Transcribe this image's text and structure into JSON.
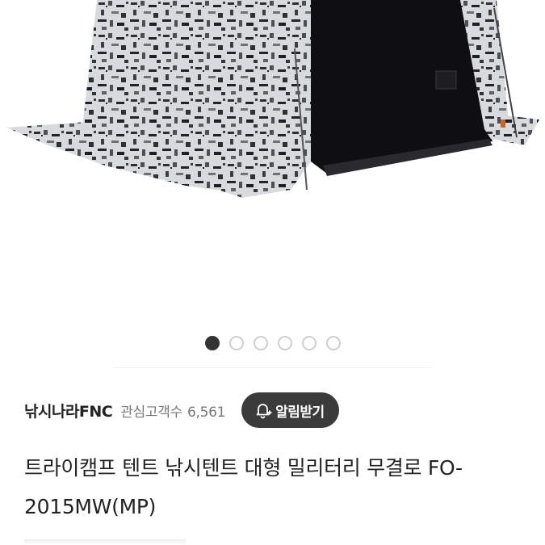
{
  "image": {
    "alt": "",
    "icon": "product-photo"
  },
  "carousel": {
    "total": 6,
    "active_index": 0
  },
  "seller": {
    "name": "낚시나라FNC",
    "followers_label": "관심고객수",
    "followers_count": "6,561",
    "alarm_button_label": "알림받기",
    "alarm_icon": "bell-plus-icon"
  },
  "product": {
    "title": "트라이캠프 텐트 낚시텐트 대형 밀리터리 무결로 FO-2015MW(MP)"
  },
  "colors": {
    "button_bg": "#3b3b3b",
    "active_dot": "#333333",
    "inactive_dot": "#cfcfcf"
  }
}
